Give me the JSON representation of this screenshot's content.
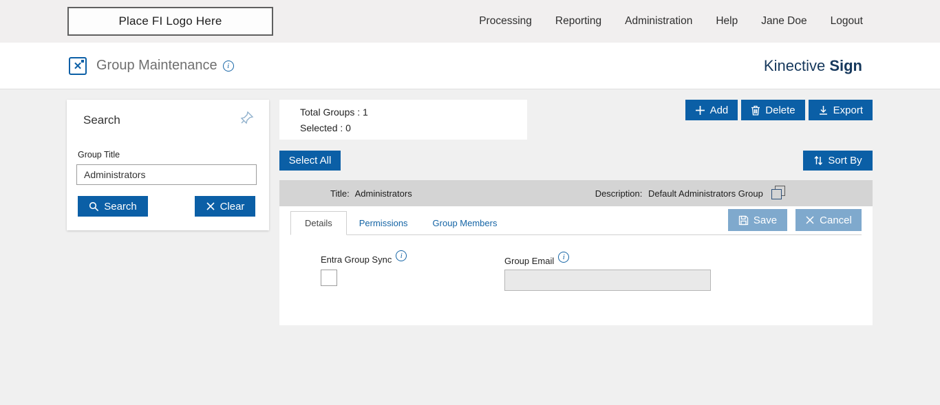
{
  "topbar": {
    "logo_placeholder": "Place FI Logo Here",
    "nav": [
      {
        "label": "Processing"
      },
      {
        "label": "Reporting"
      },
      {
        "label": "Administration"
      },
      {
        "label": "Help"
      },
      {
        "label": "Jane Doe"
      },
      {
        "label": "Logout"
      }
    ]
  },
  "header": {
    "title": "Group Maintenance",
    "brand_name": "Kinective",
    "brand_product": "Sign"
  },
  "search_panel": {
    "title": "Search",
    "group_title_label": "Group Title",
    "group_title_value": "Administrators",
    "search_button": "Search",
    "clear_button": "Clear"
  },
  "summary": {
    "total_groups": "Total Groups : 1",
    "selected": "Selected : 0"
  },
  "toolbar": {
    "add": "Add",
    "delete": "Delete",
    "export": "Export",
    "select_all": "Select All",
    "sort_by": "Sort By"
  },
  "group_row": {
    "title_label": "Title:",
    "title_value": "Administrators",
    "description_label": "Description:",
    "description_value": "Default Administrators Group"
  },
  "tabs": [
    {
      "label": "Details",
      "active": true
    },
    {
      "label": "Permissions",
      "active": false
    },
    {
      "label": "Group Members",
      "active": false
    }
  ],
  "detail_actions": {
    "save": "Save",
    "cancel": "Cancel"
  },
  "details_form": {
    "entra_group_sync_label": "Entra Group Sync",
    "entra_group_sync_checked": false,
    "group_email_label": "Group Email",
    "group_email_value": ""
  },
  "colors": {
    "primary_blue": "#0b5fa6",
    "link_blue": "#1464a5",
    "muted_blue": "#7fa9cd",
    "brand_navy": "#16385c",
    "group_header_gray": "#d4d4d4",
    "main_background": "#f0f0f0"
  }
}
